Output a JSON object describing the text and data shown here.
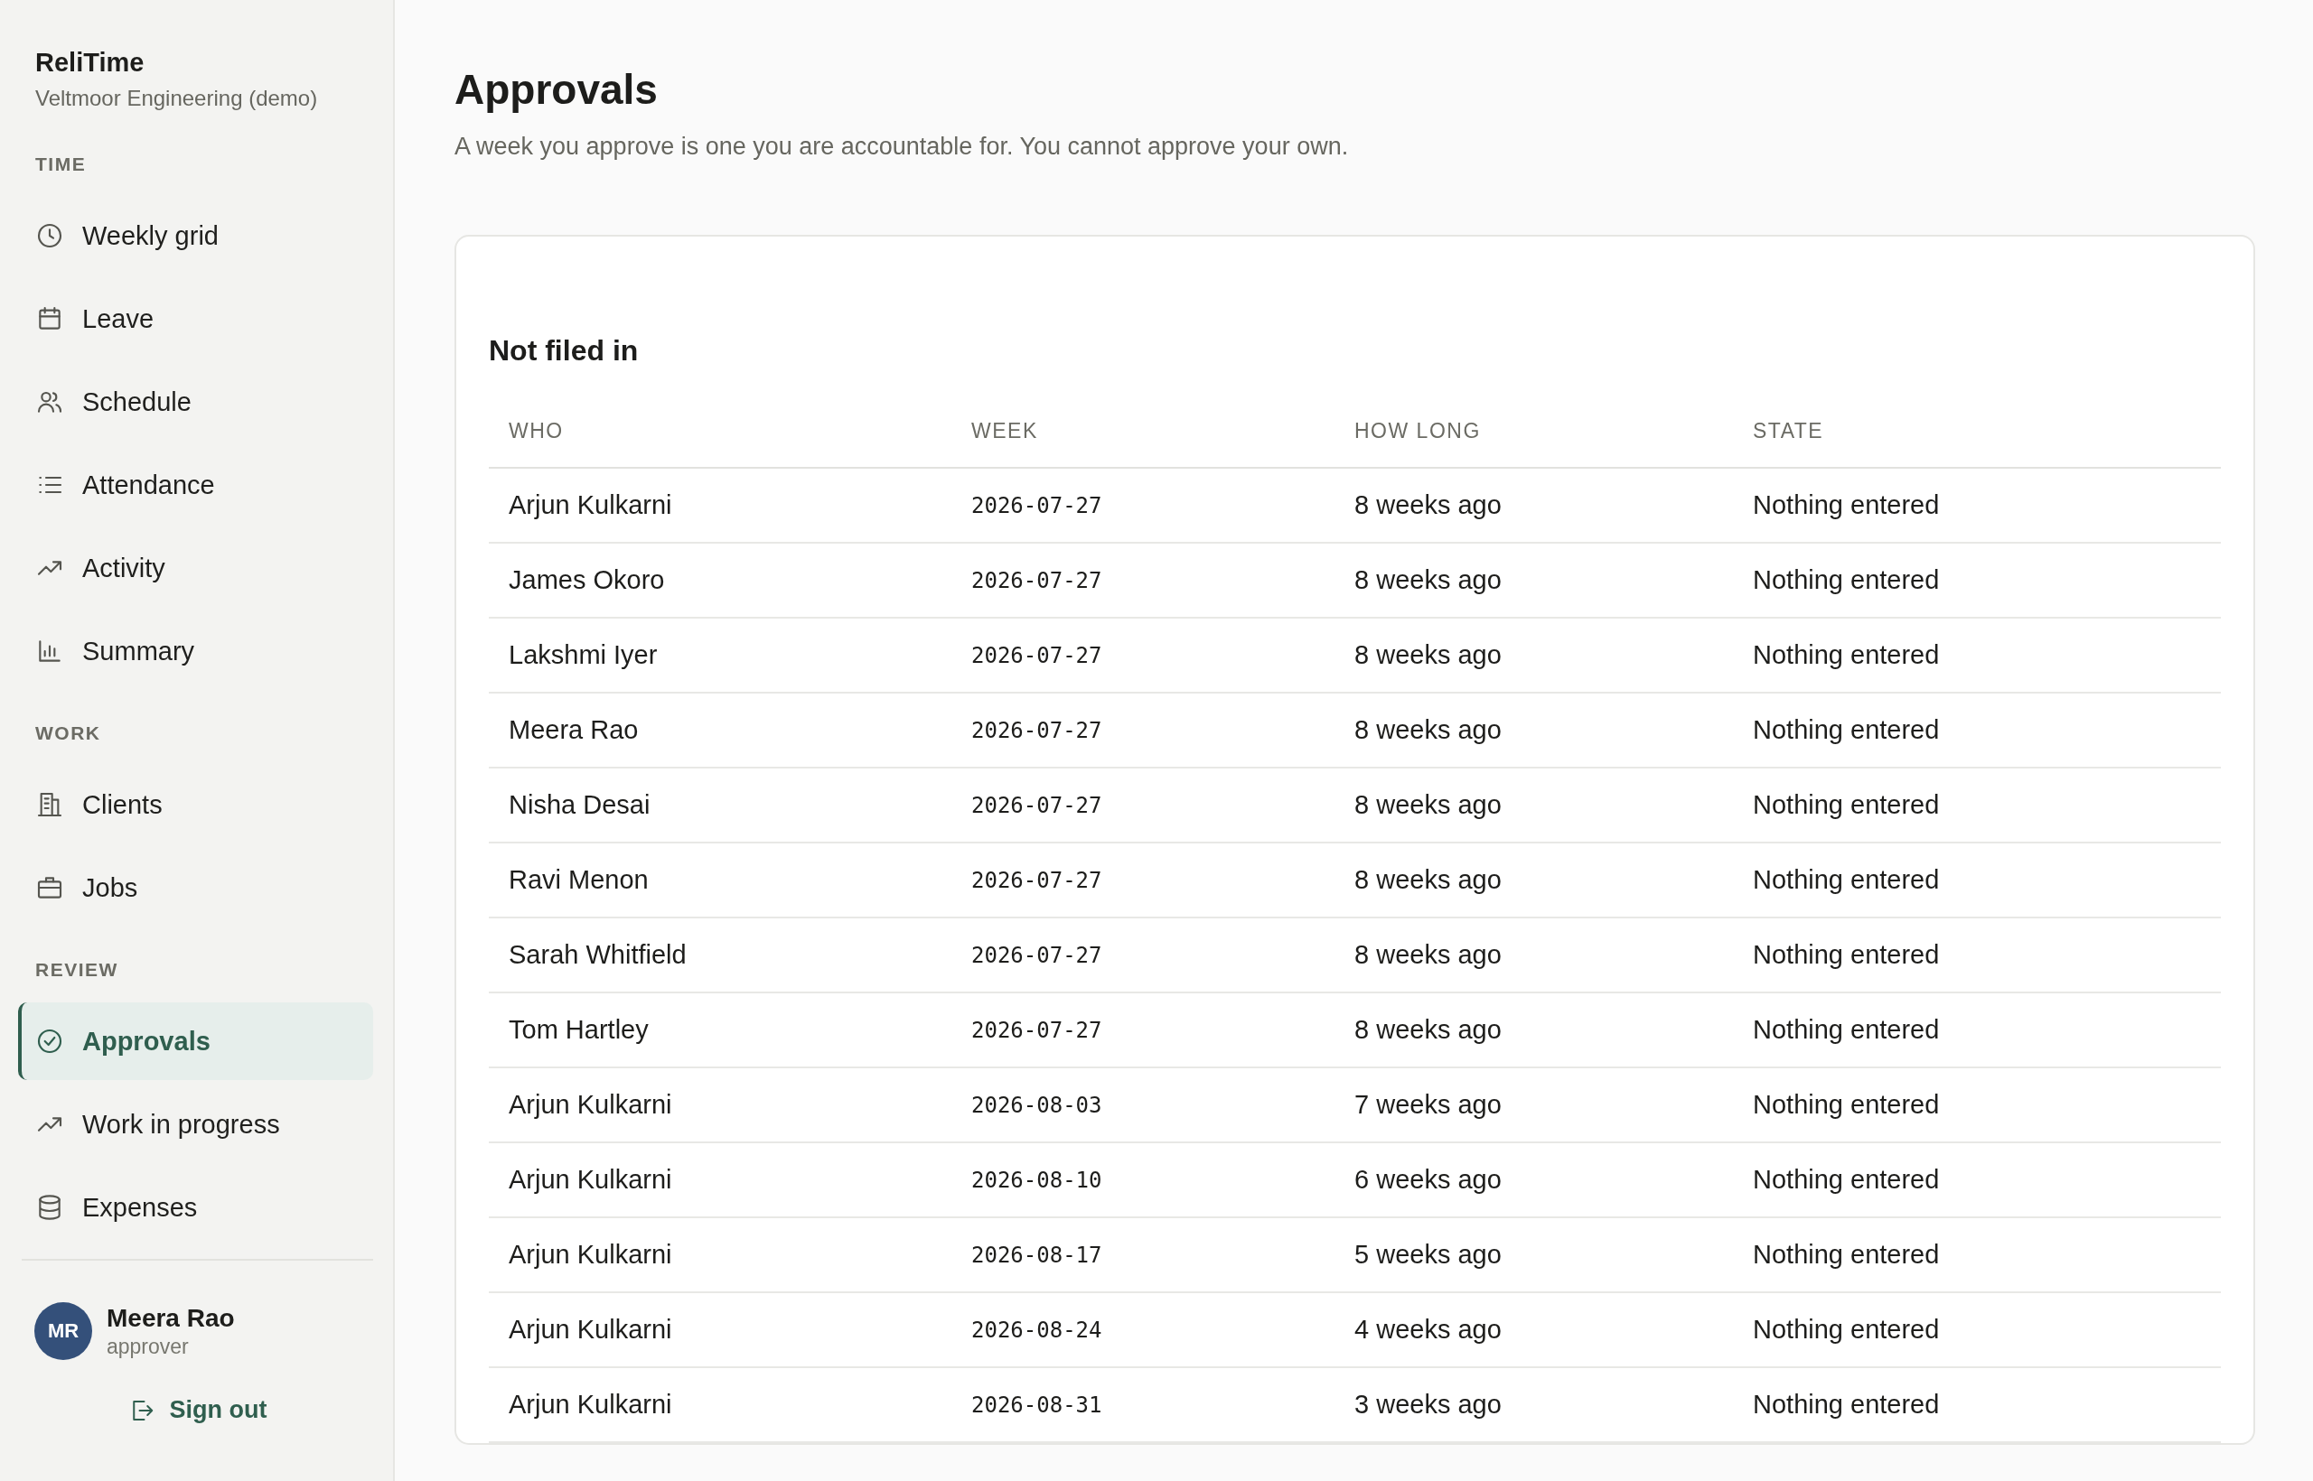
{
  "app": {
    "name": "ReliTime",
    "org": "Veltmoor Engineering (demo)"
  },
  "sidebar": {
    "sections": [
      {
        "label": "TIME",
        "items": [
          {
            "label": "Weekly grid",
            "kind": "clock",
            "selected": false
          },
          {
            "label": "Leave",
            "kind": "calendar",
            "selected": false
          },
          {
            "label": "Schedule",
            "kind": "people",
            "selected": false
          },
          {
            "label": "Attendance",
            "kind": "list",
            "selected": false
          },
          {
            "label": "Activity",
            "kind": "trend",
            "selected": false
          },
          {
            "label": "Summary",
            "kind": "bars",
            "selected": false
          }
        ]
      },
      {
        "label": "WORK",
        "items": [
          {
            "label": "Clients",
            "kind": "building",
            "selected": false
          },
          {
            "label": "Jobs",
            "kind": "briefcase",
            "selected": false
          }
        ]
      },
      {
        "label": "REVIEW",
        "items": [
          {
            "label": "Approvals",
            "kind": "check",
            "selected": true
          },
          {
            "label": "Work in progress",
            "kind": "trend",
            "selected": false
          },
          {
            "label": "Expenses",
            "kind": "database",
            "selected": false
          }
        ]
      }
    ]
  },
  "user": {
    "initials": "MR",
    "name": "Meera Rao",
    "role": "approver"
  },
  "sign_out": "Sign out",
  "page": {
    "title": "Approvals",
    "subtitle": "A week you approve is one you are accountable for. You cannot approve your own."
  },
  "card": {
    "title": "Not filed in",
    "columns": [
      "WHO",
      "WEEK",
      "HOW LONG",
      "STATE"
    ],
    "rows": [
      [
        "Arjun Kulkarni",
        "2026-07-27",
        "8 weeks ago",
        "Nothing entered"
      ],
      [
        "James Okoro",
        "2026-07-27",
        "8 weeks ago",
        "Nothing entered"
      ],
      [
        "Lakshmi Iyer",
        "2026-07-27",
        "8 weeks ago",
        "Nothing entered"
      ],
      [
        "Meera Rao",
        "2026-07-27",
        "8 weeks ago",
        "Nothing entered"
      ],
      [
        "Nisha Desai",
        "2026-07-27",
        "8 weeks ago",
        "Nothing entered"
      ],
      [
        "Ravi Menon",
        "2026-07-27",
        "8 weeks ago",
        "Nothing entered"
      ],
      [
        "Sarah Whitfield",
        "2026-07-27",
        "8 weeks ago",
        "Nothing entered"
      ],
      [
        "Tom Hartley",
        "2026-07-27",
        "8 weeks ago",
        "Nothing entered"
      ],
      [
        "Arjun Kulkarni",
        "2026-08-03",
        "7 weeks ago",
        "Nothing entered"
      ],
      [
        "Arjun Kulkarni",
        "2026-08-10",
        "6 weeks ago",
        "Nothing entered"
      ],
      [
        "Arjun Kulkarni",
        "2026-08-17",
        "5 weeks ago",
        "Nothing entered"
      ],
      [
        "Arjun Kulkarni",
        "2026-08-24",
        "4 weeks ago",
        "Nothing entered"
      ],
      [
        "Arjun Kulkarni",
        "2026-08-31",
        "3 weeks ago",
        "Nothing entered"
      ]
    ]
  }
}
